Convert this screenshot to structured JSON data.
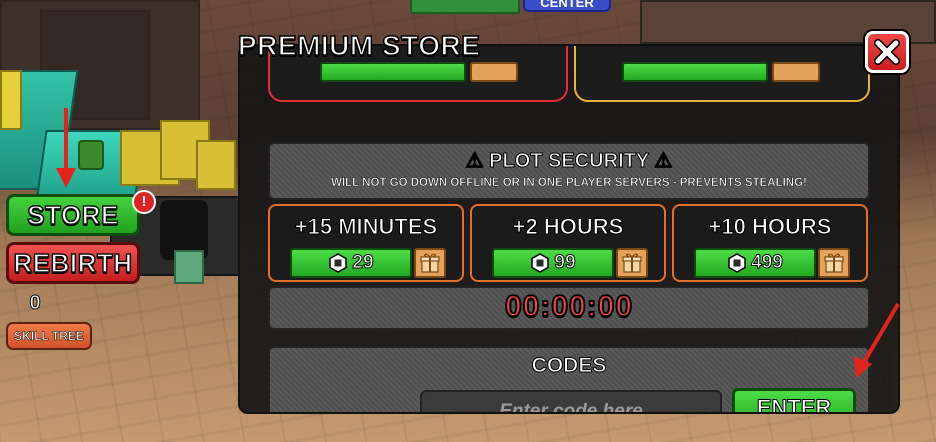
{
  "world": {
    "center_tag": "CENTER"
  },
  "hud": {
    "store_label": "STORE",
    "store_alert": "!",
    "rebirth_label": "REBIRTH",
    "rebirth_count": "0",
    "skill_tree_label": "SKILL TREE",
    "arrow_color": "#e3241d"
  },
  "store": {
    "title": "PREMIUM STORE",
    "close_icon": "close-x-icon",
    "plot_security": {
      "title": "PLOT SECURITY",
      "subtitle": "WILL NOT GO DOWN OFFLINE OR IN ONE PLAYER SERVERS - PREVENTS STEALING!",
      "options": [
        {
          "label": "+15 MINUTES",
          "price": "29"
        },
        {
          "label": "+2 HOURS",
          "price": "99"
        },
        {
          "label": "+10 HOURS",
          "price": "499"
        }
      ],
      "timer": "00:00:00"
    },
    "codes": {
      "title": "CODES",
      "placeholder": "Enter code here",
      "enter_label": "ENTER"
    },
    "colors": {
      "green_button": "#24a822",
      "gift_button": "#e5a25a",
      "option_border": "#e0702a",
      "timer_text": "#ff4444",
      "close_button": "#d82626"
    }
  }
}
